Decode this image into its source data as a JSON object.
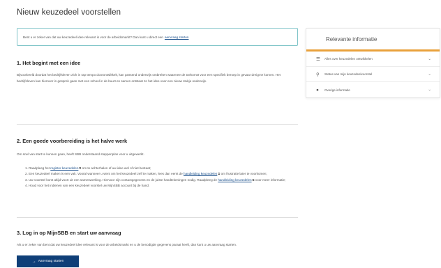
{
  "page": {
    "title": "Nieuw keuzedeel voorstellen"
  },
  "notice": {
    "text": "Bent u er zeker van dat uw keuzedeel idee relevant is voor de arbeidsmarkt? Dan kunt u direct een",
    "link": "aanvraag starten"
  },
  "sections": [
    {
      "heading": "1. Het begint met een idee",
      "paragraph": "Bijvoorbeeld doordat het bedrijfsleven zich in rap tempo doorontwikkelt, kan passend onderwijs ontbreken waarmee de toekomst voor een specifiek beroep in gevaar dreigt te komen. Het bedrijfsleven kan hierover in gesprek gaan met een school in de buurt en samen ontstaat zo het idee voor een nieuw stukje onderwijs."
    },
    {
      "heading": "2. Een goede voorbereiding is het halve werk",
      "paragraph": "Om snel van start te kunnen gaan, heeft SBB onderstaand stappenplan voor u uitgewerkt.",
      "steps": {
        "s1_pre": "1. Raadpleeg het",
        "s1_link": "register keuzedelen",
        "s1_post": "om te achterhalen of uw idee wel of niet bestaat;",
        "s2_pre": "2. Een keuzedeel maken is een vak. Vooral wanneer u vient om het keuzedeel zelf te maken, lees dan eerst de",
        "s2_link": "handleiding keuzedelen",
        "s2_post": "om frustratie later te voorkomen;",
        "s3_pre": "3. Uw voorstel komt altijd voort uit een samenwerking. Hiervoor zijn contactgegevens en de juiste handtekeningen nodig. Raadpleeg de",
        "s3_link": "handleiding keuzedelen",
        "s3_post": "voor meer informatie;",
        "s4": "4. Houd voor het indienen van een keuzedeel voorstel uw MijnSBB account bij de hand."
      }
    },
    {
      "heading": "3. Log in op MijnSBB en start uw aanvraag",
      "paragraph": "Als u er zeker van bent dat uw keuzedeel idee relevant is voor de arbeidsmarkt en u de benodigde gegevens paraat heeft, dan kunt u uw aanvraag starten."
    }
  ],
  "start_button": {
    "label": "Aanvraag starten"
  },
  "sidebar": {
    "title": "Relevante informatie",
    "items": [
      {
        "label": "Alles over keuzedelen ontwikkelen",
        "icon": "list-icon"
      },
      {
        "label": "Status van mijn keuzedeelvoorstel",
        "icon": "location-pin-icon"
      },
      {
        "label": "Overige informatie",
        "icon": "info-icon"
      }
    ]
  },
  "colors": {
    "accent": "#e9a13b",
    "notice_border": "#7fc4c8",
    "primary_button": "#0f3f78",
    "link": "#1a4f8b"
  }
}
